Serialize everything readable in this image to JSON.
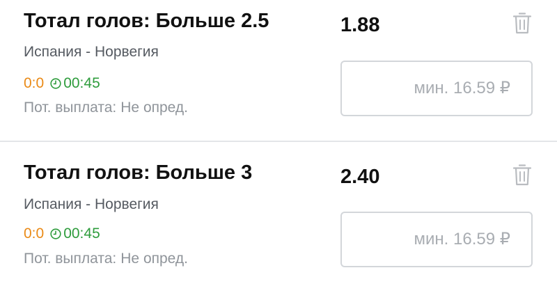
{
  "bets": [
    {
      "title": "Тотал голов: Больше 2.5",
      "odds": "1.88",
      "match": "Испания - Норвегия",
      "score": "0:0",
      "time": "00:45",
      "payout_label": "Пот. выплата:",
      "payout_value": "Не опред.",
      "stake_placeholder": "мин. 16.59 ₽"
    },
    {
      "title": "Тотал голов: Больше 3",
      "odds": "2.40",
      "match": "Испания - Норвегия",
      "score": "0:0",
      "time": "00:45",
      "payout_label": "Пот. выплата:",
      "payout_value": "Не опред.",
      "stake_placeholder": "мин. 16.59 ₽"
    }
  ],
  "icons": {
    "delete": "trash-icon",
    "live_clock": "clock-icon"
  },
  "colors": {
    "score": "#ea8a16",
    "time": "#2e9c3c",
    "muted": "#8f949a",
    "trash": "#b9bcc0"
  }
}
